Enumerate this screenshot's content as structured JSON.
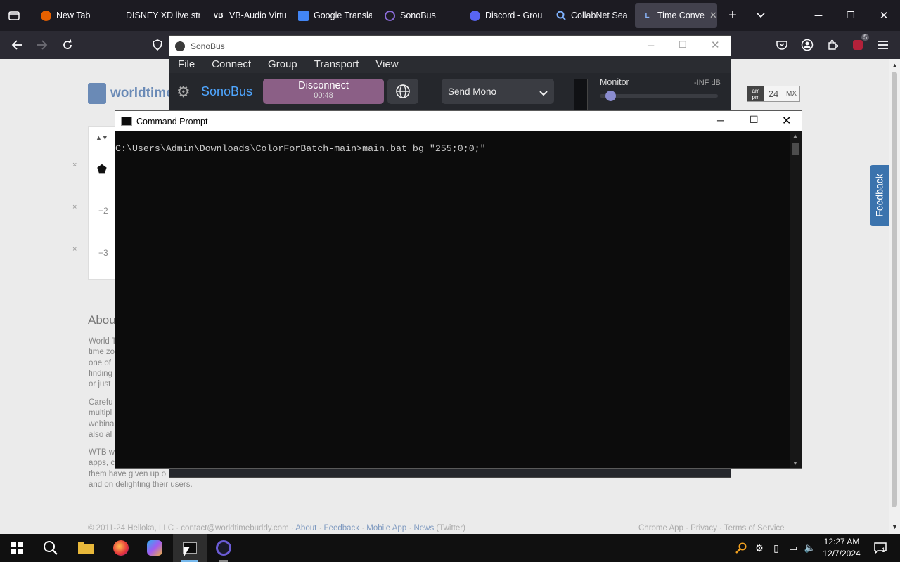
{
  "browser": {
    "tabs": [
      {
        "label": "New Tab",
        "icon": "firefox-icon"
      },
      {
        "label": "DISNEY XD live stre",
        "icon": ""
      },
      {
        "label": "VB-Audio Virtu",
        "icon": "vb-icon"
      },
      {
        "label": "Google Transla",
        "icon": "translate-icon"
      },
      {
        "label": "SonoBus",
        "icon": "sonobus-icon"
      },
      {
        "label": "Discord - Grou",
        "icon": "discord-icon"
      },
      {
        "label": "CollabNet Sea",
        "icon": "search-icon"
      },
      {
        "label": "Time Conve",
        "icon": "clock-icon",
        "active": true
      }
    ],
    "extension_badge": "5"
  },
  "page": {
    "logo_text": "worldtime",
    "rows": [
      "+2",
      "+3"
    ],
    "about_heading": "Abou",
    "para1_lines": [
      "World T",
      "time zo",
      "one of",
      "finding",
      "or just"
    ],
    "para2_lines": [
      "Carefu",
      "multipl",
      "webina",
      "also al"
    ],
    "para3_lines": [
      "WTB w",
      "apps, c",
      "them have given up o",
      "and on delighting their users."
    ],
    "ampm_top": "am",
    "ampm_bottom": "pm",
    "h24": "24",
    "mx": "MX",
    "feedback": "Feedback",
    "footer_left": "© 2011-24 Helloka, LLC",
    "footer_contact": "contact@worldtimebuddy.com",
    "footer_links": [
      "About",
      "Feedback",
      "Mobile App",
      "News"
    ],
    "footer_twitter": "(Twitter)",
    "footer_right": [
      "Chrome App",
      "Privacy",
      "Terms of Service"
    ]
  },
  "sonobus": {
    "window_title": "SonoBus",
    "menu": [
      "File",
      "Connect",
      "Group",
      "Transport",
      "View"
    ],
    "brand": "SonoBus",
    "disconnect_label": "Disconnect",
    "disconnect_time": "00:48",
    "send_mode": "Send Mono",
    "monitor_label": "Monitor",
    "monitor_db": "-INF dB",
    "monitor_level": 0.05
  },
  "cmd": {
    "window_title": "Command Prompt",
    "prompt_line": "C:\\Users\\Admin\\Downloads\\ColorForBatch-main>main.bat bg \"255;0;0;\""
  },
  "taskbar": {
    "time": "12:27 AM",
    "date": "12/7/2024",
    "notification_count": "1"
  }
}
